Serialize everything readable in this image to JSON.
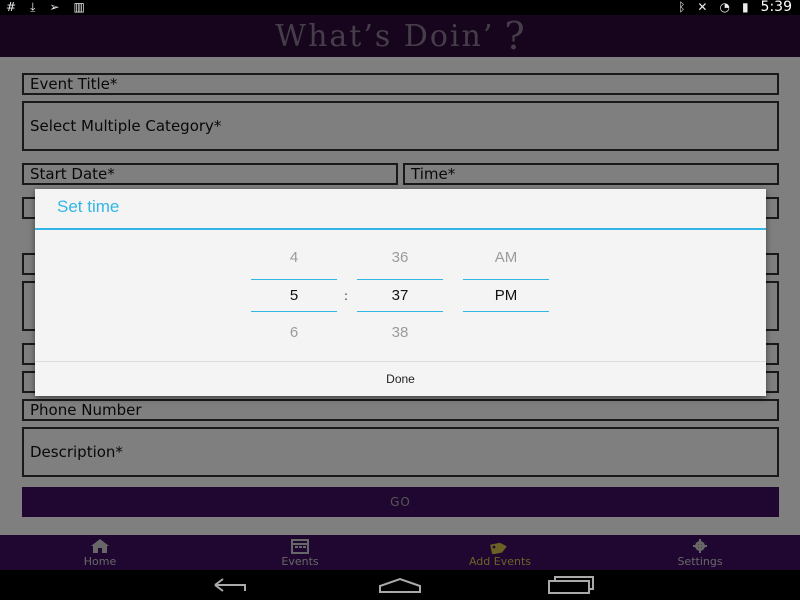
{
  "status_bar": {
    "time": "5:39",
    "left_icons": [
      "hash-icon",
      "download-icon",
      "send-icon",
      "barcode-icon"
    ],
    "right_icons": [
      "bluetooth-icon",
      "mute-icon",
      "wifi-icon",
      "battery-icon"
    ]
  },
  "header": {
    "logo_text": "What’s  Doin’",
    "logo_mark": "?"
  },
  "form": {
    "event_title": "Event Title*",
    "category": "Select Multiple Category*",
    "start_date": "Start Date*",
    "time": "Time*",
    "phone": "Phone Number",
    "description": "Description*",
    "go": "GO"
  },
  "dialog": {
    "title": "Set time",
    "hour": {
      "prev": "4",
      "current": "5",
      "next": "6"
    },
    "minute": {
      "prev": "36",
      "current": "37",
      "next": "38"
    },
    "ampm": {
      "prev": "AM",
      "current": "PM"
    },
    "separator": ":",
    "done": "Done"
  },
  "bottom_nav": [
    {
      "label": "Home",
      "icon": "home-icon",
      "active": false
    },
    {
      "label": "Events",
      "icon": "calendar-icon",
      "active": false
    },
    {
      "label": "Add Events",
      "icon": "tag-icon",
      "active": true
    },
    {
      "label": "Settings",
      "icon": "gear-icon",
      "active": false
    }
  ],
  "colors": {
    "accent": "#33b5e5",
    "header_bg": "#2c0a38",
    "nav_bg": "#3f0f63",
    "active_nav": "#d8c24b"
  }
}
